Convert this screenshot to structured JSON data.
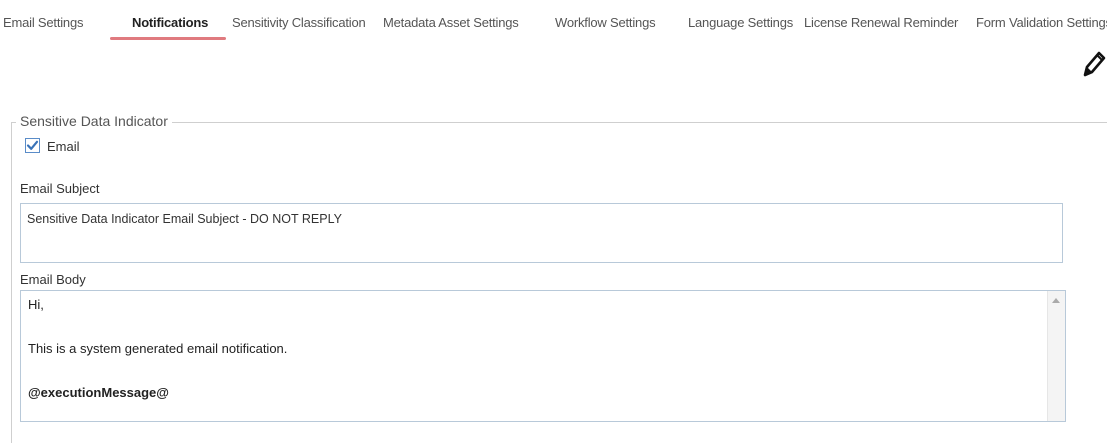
{
  "tabs": [
    {
      "label": "Email Settings"
    },
    {
      "label": "Notifications",
      "active": true
    },
    {
      "label": "Sensitivity Classification"
    },
    {
      "label": "Metadata Asset Settings"
    },
    {
      "label": "Workflow Settings"
    },
    {
      "label": "Language Settings"
    },
    {
      "label": "License Renewal Reminder"
    },
    {
      "label": "Form Validation Settings"
    }
  ],
  "edit_icon": "pencil-edit-icon",
  "section": {
    "legend": "Sensitive Data Indicator",
    "email_checkbox": {
      "label": "Email",
      "checked": true
    },
    "subject": {
      "label": "Email Subject",
      "value": "Sensitive Data Indicator Email Subject - DO NOT REPLY"
    },
    "body": {
      "label": "Email Body",
      "lines": [
        "Hi,",
        "This is a system generated email notification.",
        "@executionMessage@"
      ]
    }
  },
  "colors": {
    "active_tab_underline": "#e07a7f",
    "checkbox_accent": "#3a73b8",
    "input_border": "#b8c9d9"
  }
}
